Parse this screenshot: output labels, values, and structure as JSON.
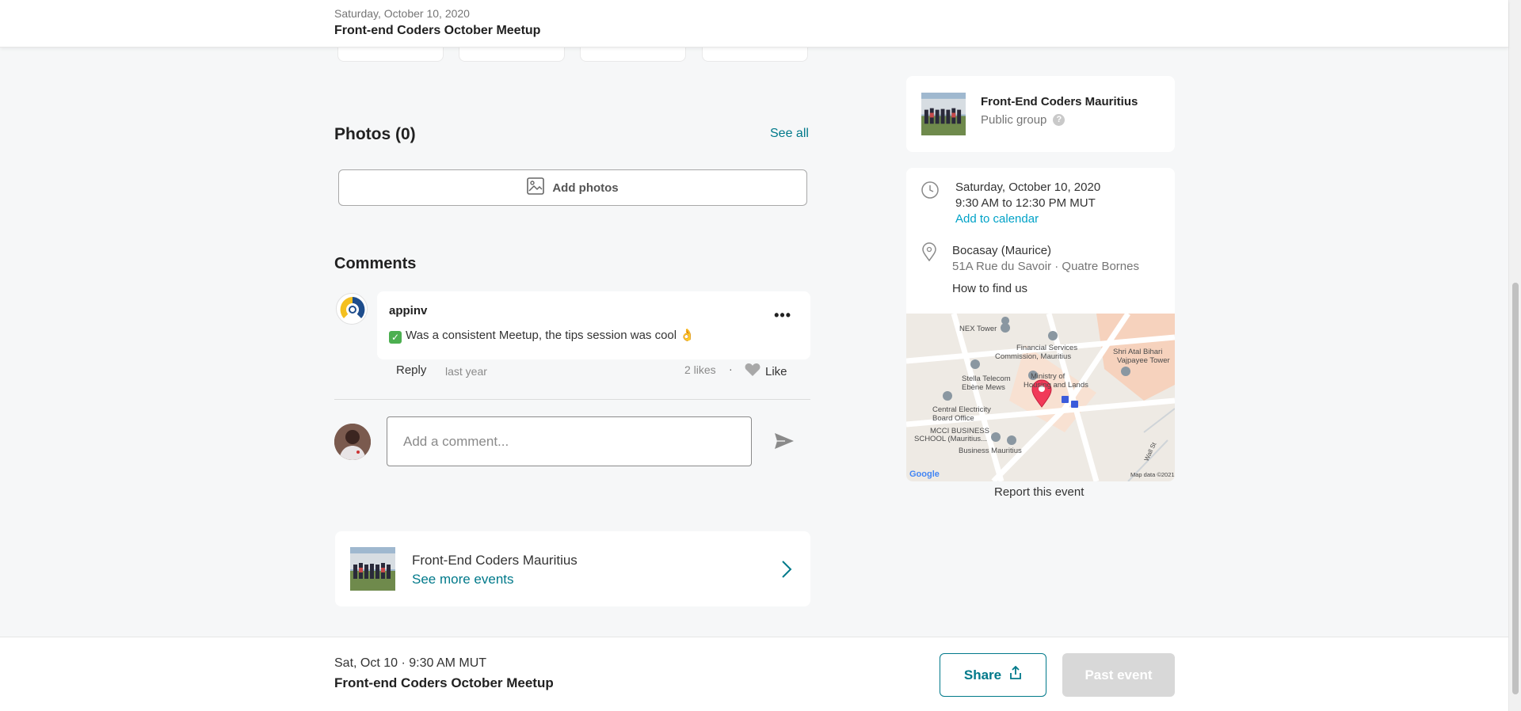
{
  "header": {
    "date": "Saturday, October 10, 2020",
    "title": "Front-end Coders October Meetup"
  },
  "photos": {
    "title": "Photos (0)",
    "see_all": "See all",
    "add_photos": "Add photos"
  },
  "comments": {
    "title": "Comments",
    "items": [
      {
        "author": "appinv",
        "text": "Was a consistent Meetup, the tips session was cool 👌",
        "reply_label": "Reply",
        "time": "last year",
        "likes": "2 likes",
        "separator": "·",
        "like_label": "Like"
      }
    ],
    "input_placeholder": "Add a comment..."
  },
  "group_card": {
    "name": "Front-End Coders Mauritius",
    "link": "See more events"
  },
  "sidebar": {
    "group": {
      "name": "Front-End Coders Mauritius",
      "type": "Public group",
      "help": "?"
    },
    "time": {
      "date": "Saturday, October 10, 2020",
      "range": "9:30 AM to 12:30 PM MUT",
      "add_calendar": "Add to calendar"
    },
    "venue": {
      "name": "Bocasay (Maurice)",
      "address": "51A Rue du Savoir · Quatre Bornes",
      "how_to_find": "How to find us"
    },
    "map": {
      "labels": [
        "NEX Tower",
        "Financial Services",
        "Commission, Mauritius",
        "Shri Atal Bihari",
        "Vajpayee Tower",
        "Stella Telecom",
        "Ebène Mews",
        "Ministry of",
        "Housing and Lands",
        "Central Electricity",
        "Board Office",
        "MCCI BUSINESS",
        "SCHOOL (Mauritius...",
        "Business Mauritius",
        "Wall St"
      ],
      "google": "Google",
      "copyright": "Map data ©2021"
    },
    "report": "Report this event"
  },
  "bottombar": {
    "when": "Sat, Oct 10 · 9:30 AM MUT",
    "title": "Front-end Coders October Meetup",
    "share": "Share",
    "past": "Past event"
  },
  "colors": {
    "accent": "#00798a",
    "link": "#00a2c7",
    "pin": "#f13a59"
  }
}
